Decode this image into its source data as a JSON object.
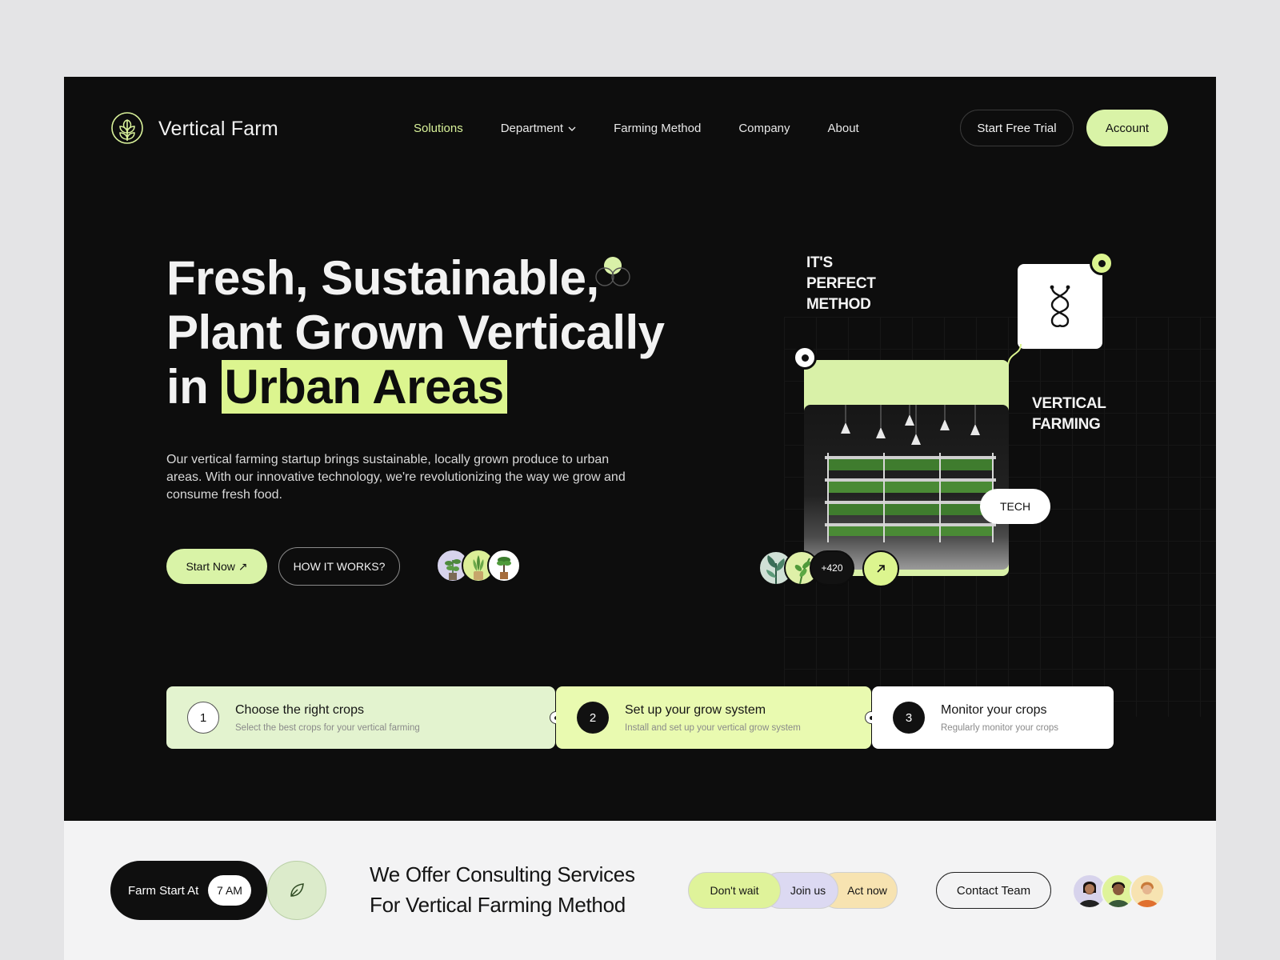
{
  "header": {
    "brand": "Vertical Farm",
    "nav": [
      {
        "label": "Solutions",
        "active": true
      },
      {
        "label": "Department",
        "dropdown": true
      },
      {
        "label": "Farming Method"
      },
      {
        "label": "Company"
      },
      {
        "label": "About"
      }
    ],
    "start_trial_label": "Start Free Trial",
    "account_label": "Account"
  },
  "hero": {
    "line1": "Fresh, Sustainable,",
    "line2_light": "Plant ",
    "line2_bold": "Grown Vertically",
    "line3_light": "in ",
    "line3_highlight": "Urban Areas",
    "description": "Our vertical farming startup brings sustainable, locally grown produce to urban areas. With our innovative technology, we're revolutionizing the way we grow and consume fresh food.",
    "start_label": "Start Now ↗",
    "how_label": "HOW IT WORKS?"
  },
  "illustration": {
    "label_method_1": "IT'S",
    "label_method_2": "PERFECT",
    "label_method_3": "METHOD",
    "label_vertical_1": "VERTICAL",
    "label_vertical_2": "FARMING",
    "tech_label": "TECH",
    "count_label": "+420"
  },
  "steps": [
    {
      "num": "1",
      "title": "Choose the right crops",
      "subtitle": "Select the best crops for your vertical farming"
    },
    {
      "num": "2",
      "title": "Set up your grow system",
      "subtitle": "Install and set up your vertical grow system"
    },
    {
      "num": "3",
      "title": "Monitor your crops",
      "subtitle": "Regularly monitor your crops"
    }
  ],
  "bottom": {
    "farm_start_label": "Farm Start At",
    "farm_start_time": "7 AM",
    "consult_line1": "We Offer Consulting Services",
    "consult_line2": "For Vertical Farming Method",
    "pills": [
      "Don't wait",
      "Join us",
      "Act now"
    ],
    "contact_label": "Contact Team"
  },
  "colors": {
    "accent_lime": "#dcf58f",
    "lime_soft": "#d9f3a7",
    "background_dark": "#0d0d0d",
    "step1_bg": "#e3f3cf",
    "step2_bg": "#e9fab0"
  }
}
